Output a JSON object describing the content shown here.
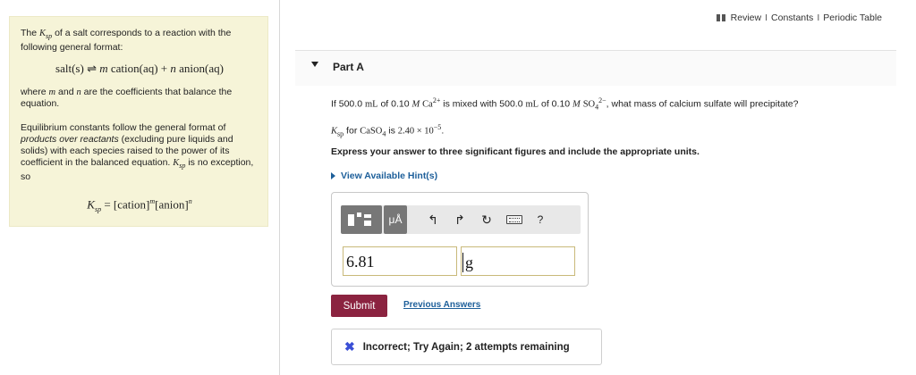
{
  "info": {
    "p1_a": "The ",
    "p1_b": " of a salt corresponds to a reaction with the following general format:",
    "ksp_main": "K",
    "ksp_sub": "sp",
    "eq1_left": "salt(s)",
    "eq1_arrow": " ⇌ ",
    "eq1_m": "m",
    "eq1_mid": " cation(aq) + ",
    "eq1_n": "n",
    "eq1_right": " anion(aq)",
    "p2_a": "where ",
    "p2_m": "m",
    "p2_b": " and ",
    "p2_n": "n",
    "p2_c": " are the coefficients that balance the equation.",
    "p3_a": "Equilibrium constants follow the general format of ",
    "p3_b": "products over reactants",
    "p3_c": " (excluding pure liquids and solids) with each species raised to the power of its coefficient in the balanced equation. ",
    "p3_d": " is no exception, so",
    "eq2_mid": " = [cation]",
    "eq2_m": "m",
    "eq2_anion": "[anion]",
    "eq2_n": "n"
  },
  "top_links": {
    "review": "Review",
    "sep": "I",
    "constants": "Constants",
    "periodic": "Periodic Table"
  },
  "part": {
    "title": "Part A"
  },
  "question": {
    "a": "If 500.0 ",
    "unit_ml": "mL",
    "b": " of 0.10 ",
    "M": "M",
    "ca": "Ca",
    "ca_charge": "2+",
    "c": " is mixed with 500.0 ",
    "d": " of 0.10 ",
    "so": "SO",
    "so_sub": "4",
    "so_charge": "2−",
    "e": ", what mass of calcium sulfate will precipitate?"
  },
  "ksp_line": {
    "k": "K",
    "k_sub": "sp",
    "a": " for ",
    "formula": "CaSO",
    "formula_sub": "4",
    "b": " is ",
    "value": "2.40 × 10",
    "exp": "−5",
    "end": "."
  },
  "instruction": "Express your answer to three significant figures and include the appropriate units.",
  "hint_label": "View Available Hint(s)",
  "toolbar": {
    "units_label": "μÅ",
    "undo": "↰",
    "redo": "↱",
    "reset": "↻",
    "help": "?"
  },
  "answer": {
    "value": "6.81",
    "unit": "g"
  },
  "submit_label": "Submit",
  "previous_label": "Previous Answers",
  "feedback": {
    "icon": "✖",
    "text": "Incorrect; Try Again; 2 attempts remaining"
  }
}
